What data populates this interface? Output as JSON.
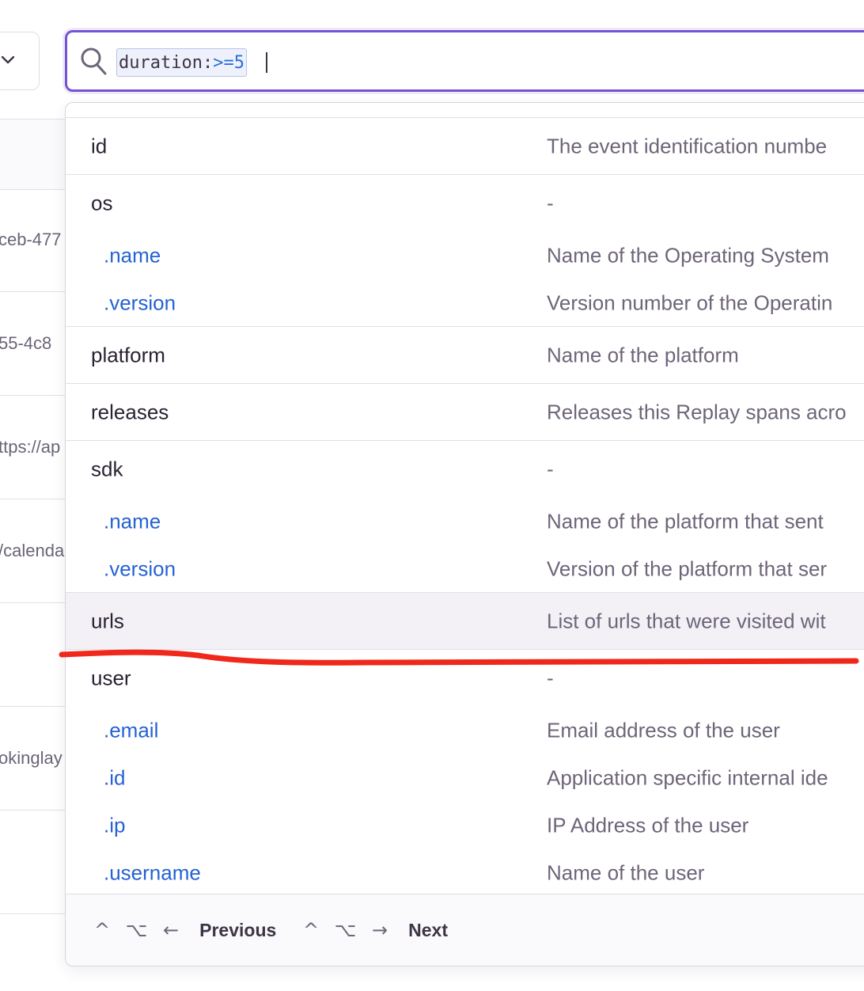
{
  "search": {
    "token_key": "duration:",
    "token_op": ">=",
    "token_value": "5"
  },
  "background_rows": [
    "",
    "ceb-477",
    "55-4c8",
    "ttps://ap",
    "/calenda",
    "",
    "okinglay",
    ""
  ],
  "suggestions": [
    {
      "key": "id",
      "desc": "The event identification numbe"
    },
    {
      "key": "os",
      "desc": "-"
    },
    {
      "key": ".name",
      "desc": "Name of the Operating System"
    },
    {
      "key": ".version",
      "desc": "Version number of the Operatin"
    },
    {
      "key": "platform",
      "desc": "Name of the platform"
    },
    {
      "key": "releases",
      "desc": "Releases this Replay spans acro"
    },
    {
      "key": "sdk",
      "desc": "-"
    },
    {
      "key": ".name",
      "desc": "Name of the platform that sent"
    },
    {
      "key": ".version",
      "desc": "Version of the platform that ser"
    },
    {
      "key": "urls",
      "desc": "List of urls that were visited wit"
    },
    {
      "key": "user",
      "desc": "-"
    },
    {
      "key": ".email",
      "desc": "Email address of the user"
    },
    {
      "key": ".id",
      "desc": "Application specific internal ide"
    },
    {
      "key": ".ip",
      "desc": "IP Address of the user"
    },
    {
      "key": ".username",
      "desc": "Name of the user"
    }
  ],
  "footer": {
    "prev_keys": "^ ⌥ ←",
    "prev_label": "Previous",
    "next_keys": "^ ⌥ →",
    "next_label": "Next"
  },
  "colors": {
    "focus_border": "#7553d4",
    "child_key": "#2562d4",
    "annotation": "#f0281c"
  },
  "active_suggestion": "urls"
}
